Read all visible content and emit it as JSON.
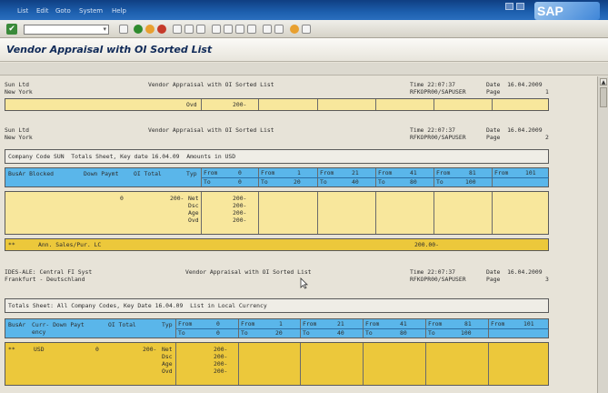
{
  "menu": {
    "items": [
      "List",
      "Edit",
      "Goto",
      "System",
      "Help"
    ]
  },
  "brand": {
    "logo": "SAP"
  },
  "toolbar": {
    "ok_glyph": "✔",
    "cmd_dropdown": "▾"
  },
  "title": "Vendor Appraisal with OI Sorted List",
  "report1": {
    "company": "Sun Ltd",
    "city": "New York",
    "report_title": "Vendor Appraisal with OI Sorted List",
    "time": "Time 22:07:37",
    "date": "Date  16.04.2009",
    "program": "RFKOPR00/SAPUSER",
    "page": "Page",
    "page_no": "1",
    "cont_label": "Ovd",
    "cont_value": "200-"
  },
  "report2": {
    "company": "Sun Ltd",
    "city": "New York",
    "report_title": "Vendor Appraisal with OI Sorted List",
    "time": "Time 22:07:37",
    "date": "Date  16.04.2009",
    "program": "RFKOPR00/SAPUSER",
    "page": "Page",
    "page_no": "2",
    "sheet_title": "Company Code SUN  Totals Sheet, Key date 16.04.09  Amounts in USD",
    "col_busar": "BusAr Blocked",
    "col_downpay": "Down Paymt",
    "col_oitotal": "OI Total",
    "col_typ": "Typ",
    "buckets": [
      {
        "from": "From",
        "from_v": "0",
        "to": "To",
        "to_v": "0"
      },
      {
        "from": "From",
        "from_v": "1",
        "to": "To",
        "to_v": "20"
      },
      {
        "from": "From",
        "from_v": "21",
        "to": "To",
        "to_v": "40"
      },
      {
        "from": "From",
        "from_v": "41",
        "to": "To",
        "to_v": "80"
      },
      {
        "from": "From",
        "from_v": "81",
        "to": "To",
        "to_v": "100"
      },
      {
        "from": "From",
        "from_v": "101",
        "to": "",
        "to_v": ""
      }
    ],
    "row_blocked": "0",
    "row_oitotal": "200-",
    "types": [
      "Net",
      "Dsc",
      "Age",
      "Ovd"
    ],
    "type_values": [
      "200-",
      "200-",
      "200-",
      "200-"
    ],
    "annual_marker": "**",
    "annual_label": "Ann. Sales/Pur. LC",
    "annual_value": "200.00-"
  },
  "report3": {
    "company": "IDES-ALE: Central FI Syst",
    "city": "Frankfurt - Deutschland",
    "report_title": "Vendor Appraisal with OI Sorted List",
    "time": "Time 22:07:37",
    "date": "Date  16.04.2009",
    "program": "RFKOPR00/SAPUSER",
    "page": "Page",
    "page_no": "3",
    "sheet_title": "Totals Sheet: All Company Codes, Key Date 16.04.09  List in Local Currency",
    "col_busar": "BusAr",
    "col_curr": "Curr- Down Payt",
    "col_curr2": "ency",
    "col_oitotal": "OI Total",
    "col_typ": "Typ",
    "buckets": [
      {
        "from": "From",
        "from_v": "0",
        "to": "To",
        "to_v": "0"
      },
      {
        "from": "From",
        "from_v": "1",
        "to": "To",
        "to_v": "20"
      },
      {
        "from": "From",
        "from_v": "21",
        "to": "To",
        "to_v": "40"
      },
      {
        "from": "From",
        "from_v": "41",
        "to": "To",
        "to_v": "80"
      },
      {
        "from": "From",
        "from_v": "81",
        "to": "To",
        "to_v": "100"
      },
      {
        "from": "From",
        "from_v": "101",
        "to": "",
        "to_v": ""
      }
    ],
    "row_marker": "**",
    "row_currency": "USD",
    "row_downpay": "0",
    "row_oitotal": "200-",
    "types": [
      "Net",
      "Dsc",
      "Age",
      "Ovd"
    ],
    "type_values": [
      "200-",
      "200-",
      "200-",
      "200-"
    ]
  },
  "scroll": {
    "up": "▲",
    "down": "▼"
  }
}
